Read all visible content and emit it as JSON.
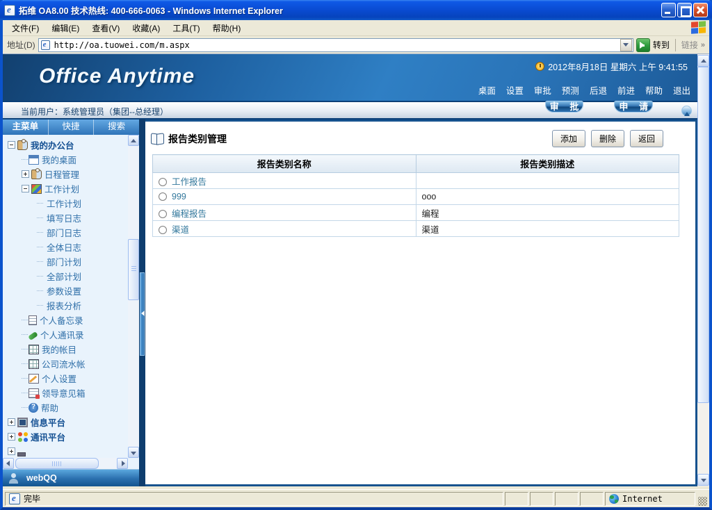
{
  "window": {
    "title": "拓维 OA8.00 技术热线: 400-666-0063 - Windows Internet Explorer"
  },
  "menubar": {
    "items": [
      "文件(F)",
      "编辑(E)",
      "查看(V)",
      "收藏(A)",
      "工具(T)",
      "帮助(H)"
    ]
  },
  "addressbar": {
    "label": "地址(D)",
    "url": "http://oa.tuowei.com/m.aspx",
    "go_label": "转到",
    "links_label": "链接"
  },
  "banner": {
    "logo": "Office Anytime",
    "datetime": "2012年8月18日 星期六  上午 9:41:55",
    "nav": [
      "桌面",
      "设置",
      "审批",
      "预测",
      "后退",
      "前进",
      "帮助",
      "退出"
    ]
  },
  "userbar": {
    "current_user": "当前用户：系统管理员（集团--总经理）",
    "approve_button": "审 批",
    "apply_button": "申 请"
  },
  "sidebar": {
    "tabs": [
      "主菜单",
      "快捷",
      "搜索"
    ],
    "tree": [
      {
        "label": "我的办公台"
      },
      {
        "label": "我的桌面"
      },
      {
        "label": "日程管理"
      },
      {
        "label": "工作计划"
      },
      {
        "label": "工作计划"
      },
      {
        "label": "填写日志"
      },
      {
        "label": "部门日志"
      },
      {
        "label": "全体日志"
      },
      {
        "label": "部门计划"
      },
      {
        "label": "全部计划"
      },
      {
        "label": "参数设置"
      },
      {
        "label": "报表分析"
      },
      {
        "label": "个人备忘录"
      },
      {
        "label": "个人通讯录"
      },
      {
        "label": "我的帐目"
      },
      {
        "label": "公司流水帐"
      },
      {
        "label": "个人设置"
      },
      {
        "label": "领导意见箱"
      },
      {
        "label": "帮助"
      },
      {
        "label": "信息平台"
      },
      {
        "label": "通讯平台"
      }
    ],
    "webqq": "webQQ"
  },
  "content": {
    "title": "报告类别管理",
    "buttons": {
      "add": "添加",
      "delete": "删除",
      "back": "返回"
    },
    "table": {
      "headers": [
        "报告类别名称",
        "报告类别描述"
      ],
      "rows": [
        {
          "name": "工作报告",
          "desc": ""
        },
        {
          "name": "999",
          "desc": "ooo"
        },
        {
          "name": "编程报告",
          "desc": "编程"
        },
        {
          "name": "渠道",
          "desc": "渠道"
        }
      ]
    }
  },
  "statusbar": {
    "status": "完毕",
    "zone": "Internet"
  },
  "icons": {
    "titlebar": "ie-page-icon",
    "datetime": "clock-icon",
    "content_title": "open-book-icon",
    "webqq": "person-icon",
    "status_left": "ie-page-icon",
    "status_zone": "globe-icon"
  },
  "colors": {
    "titlebar_blue": "#0a4cd4",
    "banner_blue": "#2f7fc4",
    "chrome_tan": "#ece9d8",
    "table_border": "#b6cce0",
    "link_teal": "#33789c",
    "tree_text": "#2f6fa8"
  }
}
